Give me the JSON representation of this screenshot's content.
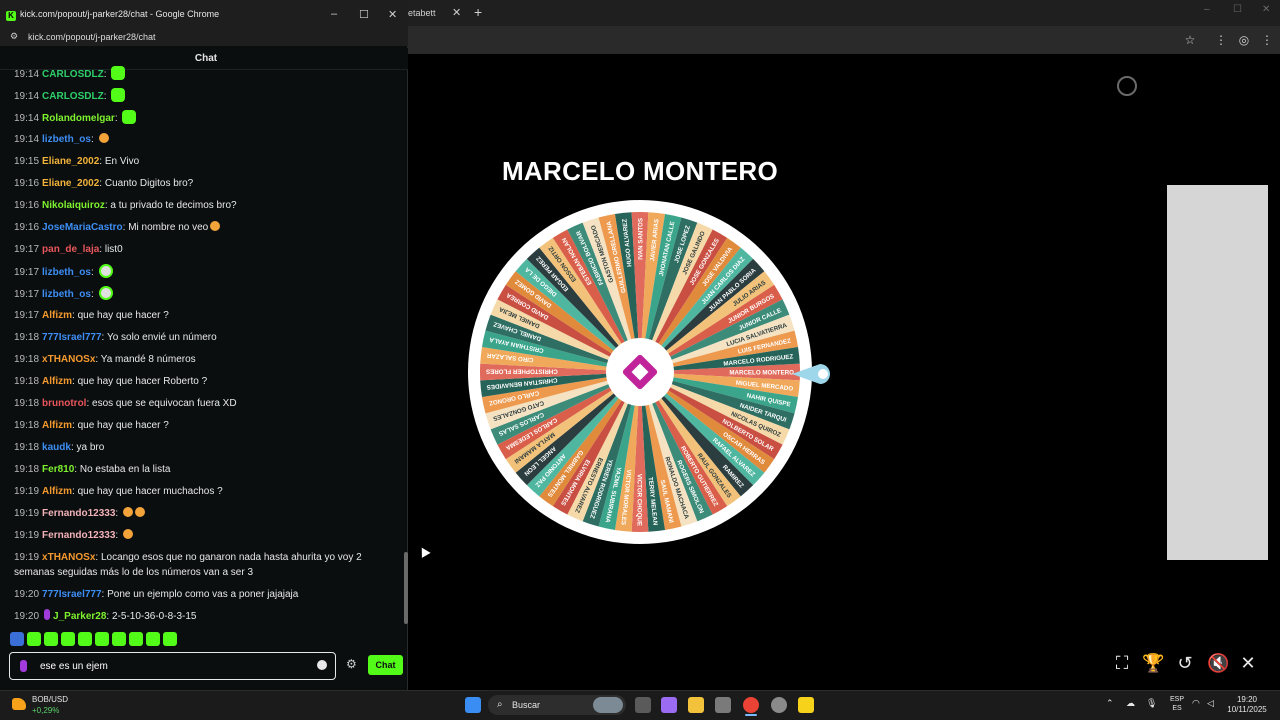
{
  "background_browser": {
    "tab_title": "etabett",
    "toolbar_icons": [
      "star-icon",
      "extensions-icon",
      "profile-icon",
      "menu-icon"
    ]
  },
  "wheel": {
    "title": "MARCELO MONTERO",
    "names": [
      "MARCELO MONTERO",
      "MIGUEL MERCADO",
      "NAHIR QUISPE",
      "NAIDER TARQUI",
      "NICOLAS QUIROZ",
      "NOLBERTO SOLAR",
      "OSCAR HERRAS",
      "RAFAEL ALVAREZ",
      "RAMIREZ",
      "RAUL GONZALES",
      "ROBERTO GUTIERREZ",
      "ROGERS SIMOLON",
      "RONALDO MACHACA",
      "SAUL MAMANI",
      "TERRY MELEAN",
      "VICTOR CHOQUE",
      "VICTOR MORALES",
      "YAZMIL SUBIRANA",
      "YERIEN RODRIGUEZ",
      "ERNESTO ALVAREZ",
      "ELVIRIA MONTES",
      "GABRIEL MONTES",
      "ANTONIO PAZ",
      "ANGEL LEON",
      "MAYLA MAMANI",
      "CARLOS LEDESMA",
      "CARLOS SALAS",
      "CATO GONZALES",
      "CARLO ORONOZ",
      "CHRISTIAN BENAVIDES",
      "CHRISTOPHER FLORES",
      "CIRO SALAZAR",
      "CRISTHIAN AYALA",
      "DANIEL CHAVEZ",
      "DANIEL MEJIA",
      "DAVID CORREA",
      "DAVID GOMEZ",
      "DIEGO DE LA",
      "EDGAR PEREZ",
      "EDSON ORTIZ",
      "ESTEBAN NOLAN",
      "FABRICIO BOLIVAR",
      "GASTON MERCADO",
      "GUILLERMO ORELLANA",
      "HUGO ALVAREZ",
      "IVAN SANTOS",
      "JAVIER ARIAS",
      "JHONATAN CALLE",
      "JOSE LOPEZ",
      "JOSE GALINDO",
      "JOSE GONZALES",
      "JOSE VALDIVIA",
      "JUAN CARLOS DIAZ",
      "JUAN PABLO SORIA",
      "JULIO ARIAS",
      "JUNIOR BURGOS",
      "JUNIOR CALLE",
      "LUCIA SALVATIERRA",
      "LUIS FERNANDEZ",
      "MARCELO RODRIGUEZ"
    ],
    "colors": [
      "#e06b5c",
      "#f0a85a",
      "#3aa58a",
      "#2f6f63",
      "#f6d9a8",
      "#c94f43",
      "#e08a3c",
      "#4fb6a0",
      "#2b3d3f",
      "#f2c27b",
      "#d95f4b",
      "#3d8c7a",
      "#f5e2c2",
      "#ed9a4f",
      "#266358"
    ]
  },
  "window": {
    "icon": "kick-logo-icon",
    "title": "kick.com/popout/j-parker28/chat - Google Chrome",
    "url": "kick.com/popout/j-parker28/chat",
    "minimize": "–",
    "maximize": "☐",
    "close": "✕"
  },
  "chat": {
    "header": "Chat",
    "messages": [
      {
        "time": "19:14",
        "user": "CARLOSDLZ",
        "color": "#2ecf6a",
        "text": "",
        "emote": "green"
      },
      {
        "time": "19:14",
        "user": "CARLOSDLZ",
        "color": "#2ecf6a",
        "text": "",
        "emote": "green"
      },
      {
        "time": "19:14",
        "user": "Rolandomelgar",
        "color": "#7ef22f",
        "text": "",
        "emote": "green"
      },
      {
        "time": "19:14",
        "user": "lizbeth_os",
        "color": "#3d8ef5",
        "text": "",
        "emote": "face"
      },
      {
        "time": "19:15",
        "user": "Eliane_2002",
        "color": "#f2b33a",
        "text": "En Vivo",
        "emote": ""
      },
      {
        "time": "19:16",
        "user": "Eliane_2002",
        "color": "#f2b33a",
        "text": "Cuanto Digitos bro?",
        "emote": ""
      },
      {
        "time": "19:16",
        "user": "Nikolaiquiroz",
        "color": "#7ef22f",
        "text": "a tu privado te decimos bro?",
        "emote": ""
      },
      {
        "time": "19:16",
        "user": "JoseMariaCastro",
        "color": "#3d8ef5",
        "text": "Mi nombre no veo",
        "emote": "face"
      },
      {
        "time": "19:17",
        "user": "pan_de_laja",
        "color": "#e8565b",
        "text": "list0",
        "emote": ""
      },
      {
        "time": "19:17",
        "user": "lizbeth_os",
        "color": "#3d8ef5",
        "text": "",
        "emote": "eyes"
      },
      {
        "time": "19:17",
        "user": "lizbeth_os",
        "color": "#3d8ef5",
        "text": "",
        "emote": "eyes"
      },
      {
        "time": "19:17",
        "user": "Alfizm",
        "color": "#f59a2f",
        "text": "que hay que hacer ?",
        "emote": ""
      },
      {
        "time": "19:18",
        "user": "777Israel777",
        "color": "#3d8ef5",
        "text": "Yo solo envié un número",
        "emote": ""
      },
      {
        "time": "19:18",
        "user": "xTHANOSx",
        "color": "#f59a2f",
        "text": "Ya mandé 8 números",
        "emote": ""
      },
      {
        "time": "19:18",
        "user": "Alfizm",
        "color": "#f59a2f",
        "text": "que hay que hacer Roberto ?",
        "emote": ""
      },
      {
        "time": "19:18",
        "user": "brunotrol",
        "color": "#e8565b",
        "text": "esos que se equivocan fuera XD",
        "emote": ""
      },
      {
        "time": "19:18",
        "user": "Alfizm",
        "color": "#f59a2f",
        "text": "que hay que hacer ?",
        "emote": ""
      },
      {
        "time": "19:18",
        "user": "kaudk",
        "color": "#3d8ef5",
        "text": "ya bro",
        "emote": ""
      },
      {
        "time": "19:18",
        "user": "Fer810",
        "color": "#7ef22f",
        "text": "No estaba en la lista",
        "emote": ""
      },
      {
        "time": "19:19",
        "user": "Alfizm",
        "color": "#f59a2f",
        "text": "que hay que hacer muchachos ?",
        "emote": ""
      },
      {
        "time": "19:19",
        "user": "Fernando12333",
        "color": "#f2b2b8",
        "text": "",
        "emote": "face2"
      },
      {
        "time": "19:19",
        "user": "Fernando12333",
        "color": "#f2b2b8",
        "text": "",
        "emote": "face"
      },
      {
        "time": "19:19",
        "user": "xTHANOSx",
        "color": "#f59a2f",
        "text": "Locango esos que no ganaron nada hasta ahurita yo voy 2 semanas seguidas más lo de los números van a ser 3",
        "emote": ""
      },
      {
        "time": "19:20",
        "user": "777Israel777",
        "color": "#3d8ef5",
        "text": "Pone un ejemplo como vas a poner jajajaja",
        "emote": ""
      },
      {
        "time": "19:20",
        "user": "J_Parker28",
        "color": "#7ef22f",
        "text": "2-5-10-36-0-8-3-15",
        "emote": "",
        "badge": "mic"
      }
    ],
    "input_value": "ese es un ejem",
    "send_label": "Chat"
  },
  "taskbar": {
    "stock_name": "BOB/USD",
    "stock_change": "+0,29%",
    "search_text": "Buscar",
    "lang_line1": "ESP",
    "lang_line2": "ES",
    "time": "19:20",
    "date": "10/11/2025"
  }
}
